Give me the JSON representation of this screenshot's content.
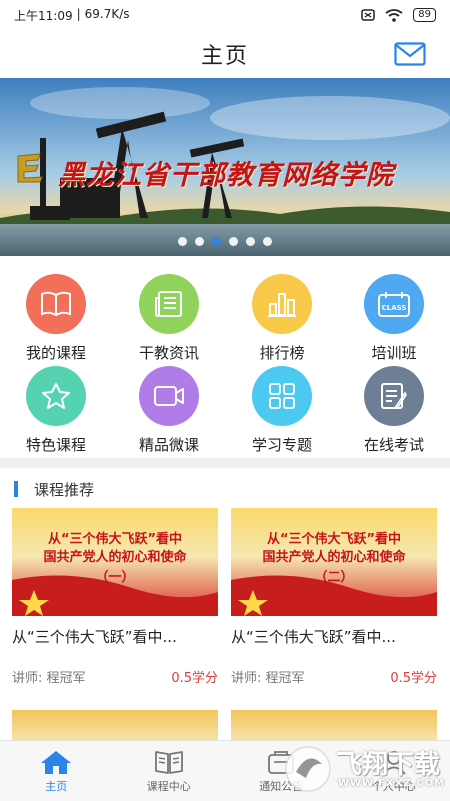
{
  "status_bar": {
    "time": "上午11:09",
    "speed": "69.7K/s",
    "battery": "89"
  },
  "header": {
    "title": "主页"
  },
  "banner": {
    "title": "黑龙江省干部教育网络学院",
    "dot_count": 6,
    "active_dot": 2
  },
  "menu": [
    {
      "label": "我的课程",
      "color": "#f26f5a",
      "icon": "book-icon"
    },
    {
      "label": "干教资讯",
      "color": "#8fd35c",
      "icon": "news-icon"
    },
    {
      "label": "排行榜",
      "color": "#f9c94a",
      "icon": "chart-icon"
    },
    {
      "label": "培训班",
      "color": "#4ea8f2",
      "icon": "class-calendar-icon",
      "badge": "CLASS"
    },
    {
      "label": "特色课程",
      "color": "#55d3b0",
      "icon": "star-icon"
    },
    {
      "label": "精品微课",
      "color": "#b07de8",
      "icon": "video-icon"
    },
    {
      "label": "学习专题",
      "color": "#4cc9f0",
      "icon": "grid-icon"
    },
    {
      "label": "在线考试",
      "color": "#6e7f95",
      "icon": "exam-icon"
    }
  ],
  "section": {
    "title": "课程推荐"
  },
  "courses": [
    {
      "thumb_line1": "从“三个伟大飞跃”看中",
      "thumb_line2": "国共产党人的初心和使命",
      "thumb_line3": "（一）",
      "title": "从“三个伟大飞跃”看中...",
      "teacher": "讲师: 程冠军",
      "credit": "0.5学分"
    },
    {
      "thumb_line1": "从“三个伟大飞跃”看中",
      "thumb_line2": "国共产党人的初心和使命",
      "thumb_line3": "（二）",
      "title": "从“三个伟大飞跃”看中...",
      "teacher": "讲师: 程冠军",
      "credit": "0.5学分"
    }
  ],
  "tabbar": [
    {
      "label": "主页",
      "icon": "home-icon",
      "active": true
    },
    {
      "label": "课程中心",
      "icon": "open-book-icon"
    },
    {
      "label": "通知公告",
      "icon": "bell-icon"
    },
    {
      "label": "个人中心",
      "icon": "person-icon"
    }
  ],
  "watermark": {
    "text": "飞翔下载",
    "url": "WWW.FXXZ.COM"
  },
  "colors": {
    "accent": "#2b84e8",
    "credit": "#e23b3b"
  }
}
